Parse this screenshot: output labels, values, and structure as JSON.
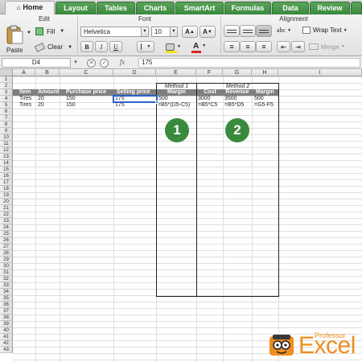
{
  "ribbon": {
    "tabs": [
      {
        "label": "Home",
        "active": true
      },
      {
        "label": "Layout"
      },
      {
        "label": "Tables"
      },
      {
        "label": "Charts"
      },
      {
        "label": "SmartArt"
      },
      {
        "label": "Formulas"
      },
      {
        "label": "Data"
      },
      {
        "label": "Review"
      }
    ],
    "groups": {
      "edit": "Edit",
      "font": "Font",
      "alignment": "Alignment"
    },
    "paste_label": "Paste",
    "fill_label": "Fill",
    "clear_label": "Clear",
    "font_name": "Helvetica",
    "font_size": "10",
    "bold": "B",
    "italic": "I",
    "underline": "U",
    "font_grow": "A",
    "font_shrink": "A",
    "fill_color_icon": "paint-bucket-icon",
    "font_color_label": "A",
    "font_color": "#e02020",
    "fill_color": "#f2e21a",
    "abc_label": "abc",
    "wrap_text_label": "Wrap Text",
    "merge_label": "Merge"
  },
  "formula_bar": {
    "name_box": "D4",
    "fx_label": "fx",
    "value": "175"
  },
  "columns": [
    "A",
    "B",
    "C",
    "D",
    "E",
    "F",
    "G",
    "H",
    "I"
  ],
  "rows": [
    "1",
    "2",
    "3",
    "4",
    "5",
    "6",
    "7",
    "8",
    "9",
    "10",
    "11",
    "12",
    "13",
    "14",
    "15",
    "16",
    "17",
    "18",
    "19",
    "20",
    "21",
    "22",
    "23",
    "24",
    "25",
    "26",
    "27",
    "28",
    "29",
    "30",
    "31",
    "32",
    "33",
    "34",
    "35",
    "36",
    "37",
    "38",
    "39",
    "40",
    "41",
    "42",
    "43"
  ],
  "sheet": {
    "method1_title": "Method 1",
    "method2_title": "Method 2",
    "headers": [
      "Item",
      "Amount",
      "Purchase price",
      "Selling price",
      "Margin",
      "Cost",
      "Revenue",
      "Margin"
    ],
    "row4": [
      "Tires",
      "20",
      "150",
      "175",
      "500",
      "3000",
      "3500",
      "500"
    ],
    "row5": [
      "Tires",
      "20",
      "150",
      "175",
      "=B5*(D5-C5)",
      "=B5*C5",
      "=B5*D5",
      "=G5-F5"
    ],
    "circle1": "1",
    "circle2": "2",
    "accent_color": "#3a8a3e"
  },
  "logo": {
    "small_text": "Professor",
    "big_text": "Excel",
    "color": "#f08d1f"
  }
}
